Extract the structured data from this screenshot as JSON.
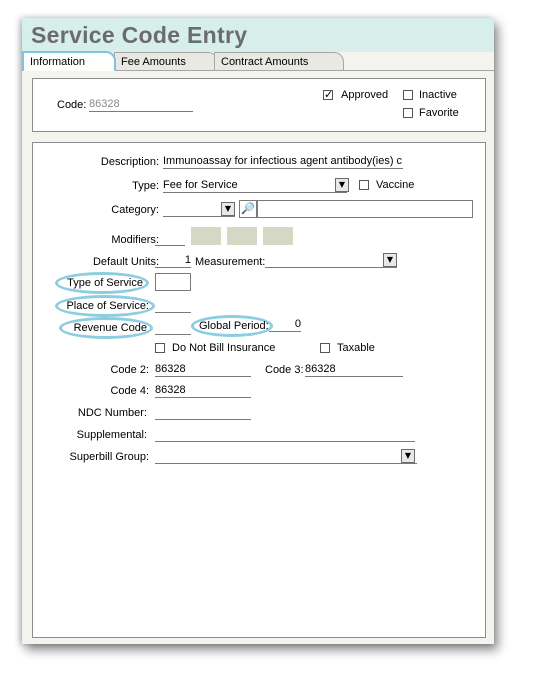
{
  "title": "Service Code Entry",
  "tabs": [
    {
      "label": "Information"
    },
    {
      "label": "Fee Amounts"
    },
    {
      "label": "Contract Amounts"
    }
  ],
  "header": {
    "code_label": "Code:",
    "code_value": "86328",
    "approved_label": "Approved",
    "approved_checked": true,
    "inactive_label": "Inactive",
    "inactive_checked": false,
    "favorite_label": "Favorite",
    "favorite_checked": false
  },
  "form": {
    "description_label": "Description:",
    "description_value": "Immunoassay for infectious agent antibody(ies)  c",
    "type_label": "Type:",
    "type_value": "Fee for Service",
    "vaccine_label": "Vaccine",
    "category_label": "Category:",
    "category_value": "",
    "modifiers_label": "Modifiers:",
    "default_units_label": "Default Units:",
    "default_units_value": "1",
    "measurement_label": "Measurement:",
    "measurement_value": "",
    "type_of_service_label": "Type of Service",
    "place_of_service_label": "Place of Service:",
    "revenue_code_label": "Revenue Code",
    "global_period_label": "Global Period:",
    "global_period_value": "0",
    "do_not_bill_label": "Do Not Bill Insurance",
    "taxable_label": "Taxable",
    "code2_label": "Code 2:",
    "code2_value": "86328",
    "code3_label": "Code 3:",
    "code3_value": "86328",
    "code4_label": "Code 4:",
    "code4_value": "86328",
    "ndc_label": "NDC Number:",
    "ndc_value": "",
    "supplemental_label": "Supplemental:",
    "supplemental_value": "",
    "superbill_label": "Superbill Group:",
    "superbill_value": ""
  },
  "colors": {
    "title_bar": "#d7efea",
    "highlight_ellipse": "#8ccde0",
    "active_tab_border": "#7fc3dc"
  },
  "icons": [
    "magnifier-icon",
    "dropdown-arrow-icon",
    "checkmark-icon"
  ]
}
